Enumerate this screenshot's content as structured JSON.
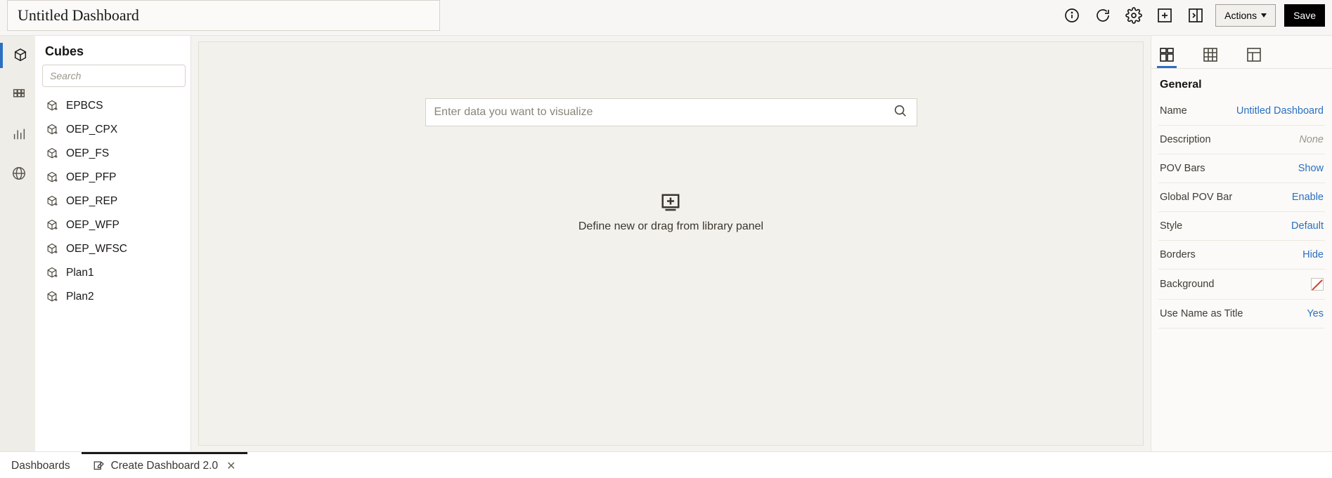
{
  "header": {
    "title_value": "Untitled Dashboard",
    "actions_label": "Actions",
    "save_label": "Save"
  },
  "cubes": {
    "title": "Cubes",
    "search_placeholder": "Search",
    "items": [
      "EPBCS",
      "OEP_CPX",
      "OEP_FS",
      "OEP_PFP",
      "OEP_REP",
      "OEP_WFP",
      "OEP_WFSC",
      "Plan1",
      "Plan2"
    ]
  },
  "canvas": {
    "search_placeholder": "Enter data you want to visualize",
    "drop_hint": "Define new or drag from library panel"
  },
  "properties": {
    "section_title": "General",
    "rows": {
      "name": {
        "label": "Name",
        "value": "Untitled Dashboard"
      },
      "description": {
        "label": "Description",
        "value": "None"
      },
      "pov_bars": {
        "label": "POV Bars",
        "value": "Show"
      },
      "global_pov": {
        "label": "Global POV Bar",
        "value": "Enable"
      },
      "style": {
        "label": "Style",
        "value": "Default"
      },
      "borders": {
        "label": "Borders",
        "value": "Hide"
      },
      "background": {
        "label": "Background"
      },
      "use_name_as_title": {
        "label": "Use Name as Title",
        "value": "Yes"
      }
    }
  },
  "bottom_tabs": {
    "dashboards": "Dashboards",
    "create": "Create Dashboard 2.0"
  }
}
